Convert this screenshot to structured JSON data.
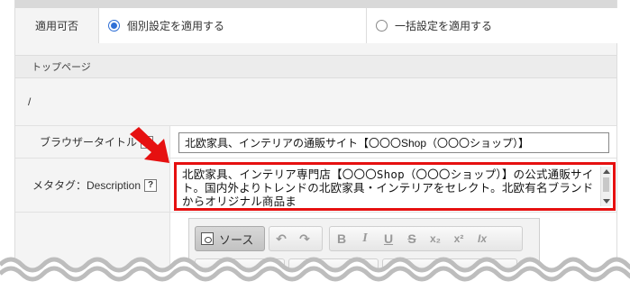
{
  "apply": {
    "label": "適用可否",
    "options": [
      {
        "label": "個別設定を適用する",
        "checked": true
      },
      {
        "label": "一括設定を適用する",
        "checked": false
      }
    ]
  },
  "section": {
    "title": "トップページ",
    "path": "/"
  },
  "fields": {
    "title_label": "ブラウザータイトル",
    "title_value": "北欧家具、インテリアの通販サイト【〇〇〇Shop（〇〇〇ショップ）】",
    "description_label": "メタタグ：Description",
    "help_symbol": "?",
    "description_value": "北欧家具、インテリア専門店【〇〇〇Shop（〇〇〇ショップ）】の公式通販サイト。国内外よりトレンドの北欧家具・インテリアをセレクト。北欧有名ブランドからオリジナル商品ま"
  },
  "editor": {
    "source_label": "ソース",
    "icons": [
      "undo-icon",
      "redo-icon",
      "bold-icon",
      "italic-icon",
      "underline-icon",
      "strikethrough-icon",
      "subscript-icon",
      "superscript-icon",
      "clear-format-icon"
    ],
    "glyphs": {
      "undo": "↶",
      "redo": "↷",
      "bold": "B",
      "italic": "I",
      "underline": "U",
      "strike": "S",
      "sub": "x₂",
      "sup": "x²",
      "clear": "Ix"
    }
  },
  "colors": {
    "highlight": "#e61010",
    "radio_accent": "#2f6fd6"
  }
}
